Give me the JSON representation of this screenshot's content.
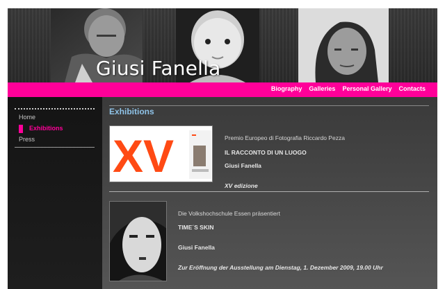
{
  "header": {
    "site_title": "Giusi Fanella"
  },
  "nav": {
    "items": [
      {
        "label": "Biography"
      },
      {
        "label": "Galleries"
      },
      {
        "label": "Personal Gallery"
      },
      {
        "label": "Contacts"
      }
    ]
  },
  "sidebar": {
    "items": [
      {
        "label": "Home"
      },
      {
        "label": "Exhibitions",
        "active": true
      },
      {
        "label": "Press"
      }
    ]
  },
  "main": {
    "title": "Exhibitions",
    "entries": [
      {
        "organizer": "Premio Europeo di Fotografia Riccardo Pezza",
        "exhibition_title": "IL RACCONTO DI UN LUOGO",
        "artist": "Giusi Fanella",
        "detail": "XV edizione",
        "image_text": "XV"
      },
      {
        "organizer": "Die Volkshochschule Essen präsentiert",
        "exhibition_title": "TIME´S SKIN",
        "artist": "Giusi Fanella",
        "detail": "Zur Eröffnung der Ausstellung am Dienstag, 1. Dezember 2009, 19.00 Uhr"
      }
    ]
  },
  "colors": {
    "accent": "#ff0099",
    "title_blue": "#8fc3e8"
  }
}
